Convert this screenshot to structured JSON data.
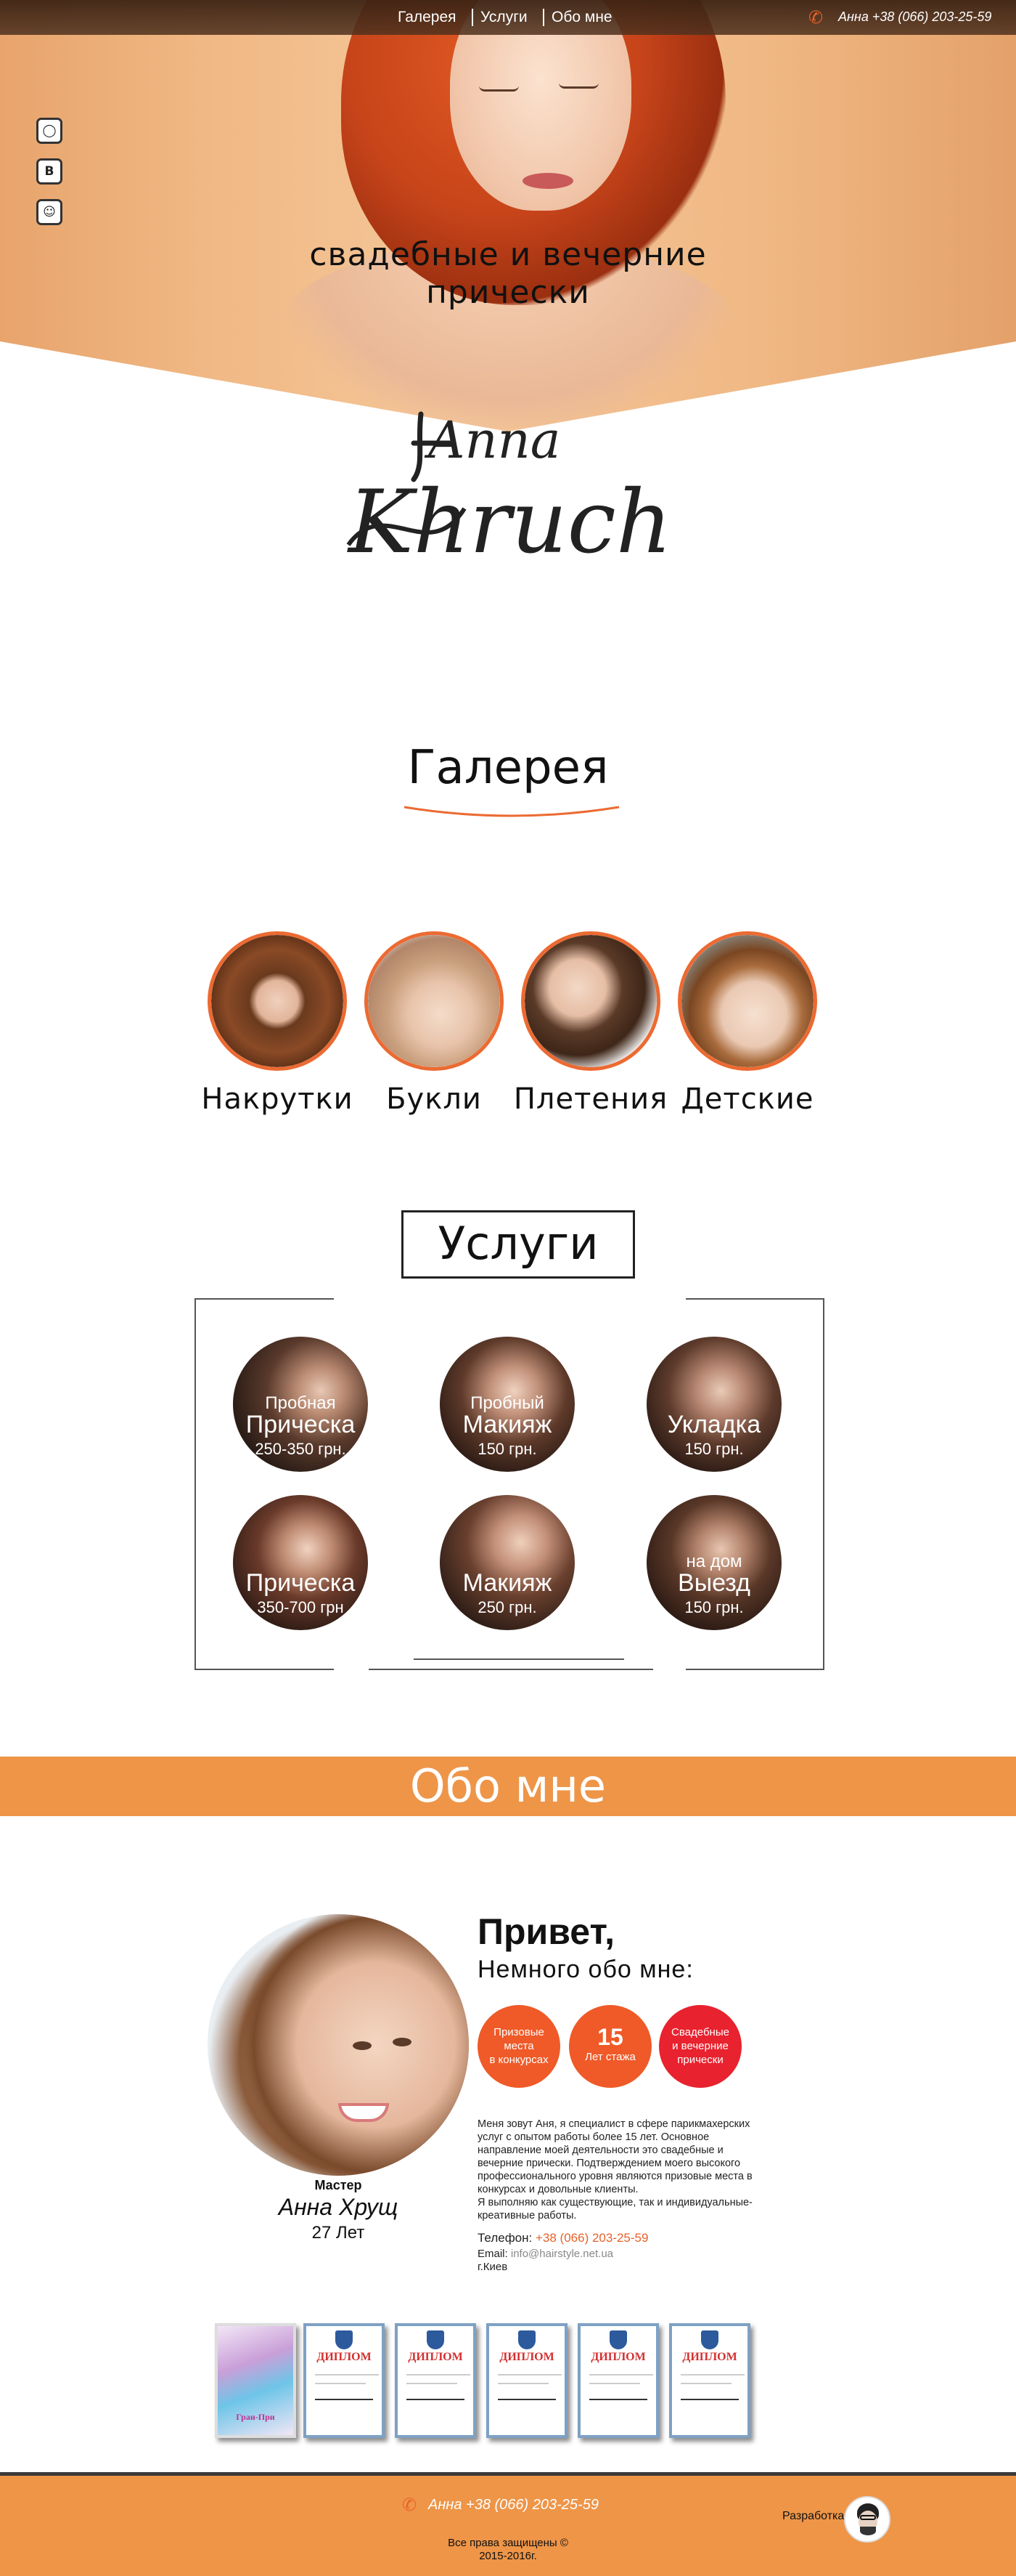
{
  "nav": {
    "items": [
      "Галерея",
      "Услуги",
      "Обо мне"
    ],
    "phone": "Анна +38 (066) 203-25-59"
  },
  "social": [
    "instagram-icon",
    "vk-icon",
    "odnoklassniki-icon"
  ],
  "hero": {
    "tagline_line1": "свадебные и вечерние",
    "tagline_line2": "прически"
  },
  "logo": {
    "line1": "Anna",
    "line2": "Khruch"
  },
  "gallery": {
    "title": "Галерея",
    "items": [
      "Накрутки",
      "Букли",
      "Плетения",
      "Детские"
    ]
  },
  "services": {
    "title": "Услуги",
    "items": [
      {
        "top": "Пробная",
        "name": "Прическа",
        "price": "250-350 грн."
      },
      {
        "top": "Пробный",
        "name": "Макияж",
        "price": "150 грн."
      },
      {
        "top": "",
        "name": "Укладка",
        "price": "150 грн."
      },
      {
        "top": "",
        "name": "Прическа",
        "price": "350-700 грн"
      },
      {
        "top": "",
        "name": "Макияж",
        "price": "250 грн."
      },
      {
        "top": "на дом",
        "name": "Выезд",
        "price": "150 грн."
      }
    ]
  },
  "about": {
    "title": "Обо мне",
    "master_label": "Мастер",
    "master_name": "Анна Хрущ",
    "master_age": "27 Лет",
    "hello": "Привет,",
    "subtitle": "Немного обо мне:",
    "stats": [
      {
        "line1": "Призовые",
        "line2": "места",
        "line3": "в конкурсах",
        "big": ""
      },
      {
        "line1": "",
        "line2": "",
        "line3": "Лет стажа",
        "big": "15"
      },
      {
        "line1": "Свадебные",
        "line2": "и вечерние",
        "line3": "прически",
        "big": ""
      }
    ],
    "bio_lines": [
      "Меня зовут Аня, я специалист в сфере парикмахерских",
      "услуг с опытом работы более 15 лет. Основное",
      "направление моей деятельности это свадебные и",
      "вечерние прически. Подтверждением моего высокого",
      "профессионального уровня являются призовые места в",
      "конкурсах и довольные клиенты.",
      "Я выполняю как существующие, так и индивидуальные-",
      "креативные работы."
    ],
    "phone_label": "Телефон:",
    "phone_value": "+38 (066) 203-25-59",
    "email_label": "Email:",
    "email_value": "info@hairstyle.net.ua",
    "city": "г.Киев",
    "diplomas": [
      "Гран-При",
      "ДИПЛОМ",
      "ДИПЛОМ",
      "ДИПЛОМ",
      "ДИПЛОМ",
      "ДИПЛОМ"
    ]
  },
  "footer": {
    "phone": "Анна +38 (066) 203-25-59",
    "copy_line1": "Все права защищены ©",
    "copy_line2": "2015-2016г.",
    "developer_label": "Разработка"
  },
  "colors": {
    "accent": "#ec6a32",
    "orange_bar": "#ee9548",
    "stat_orange": "#ef5a28",
    "stat_red": "#e8222e"
  }
}
